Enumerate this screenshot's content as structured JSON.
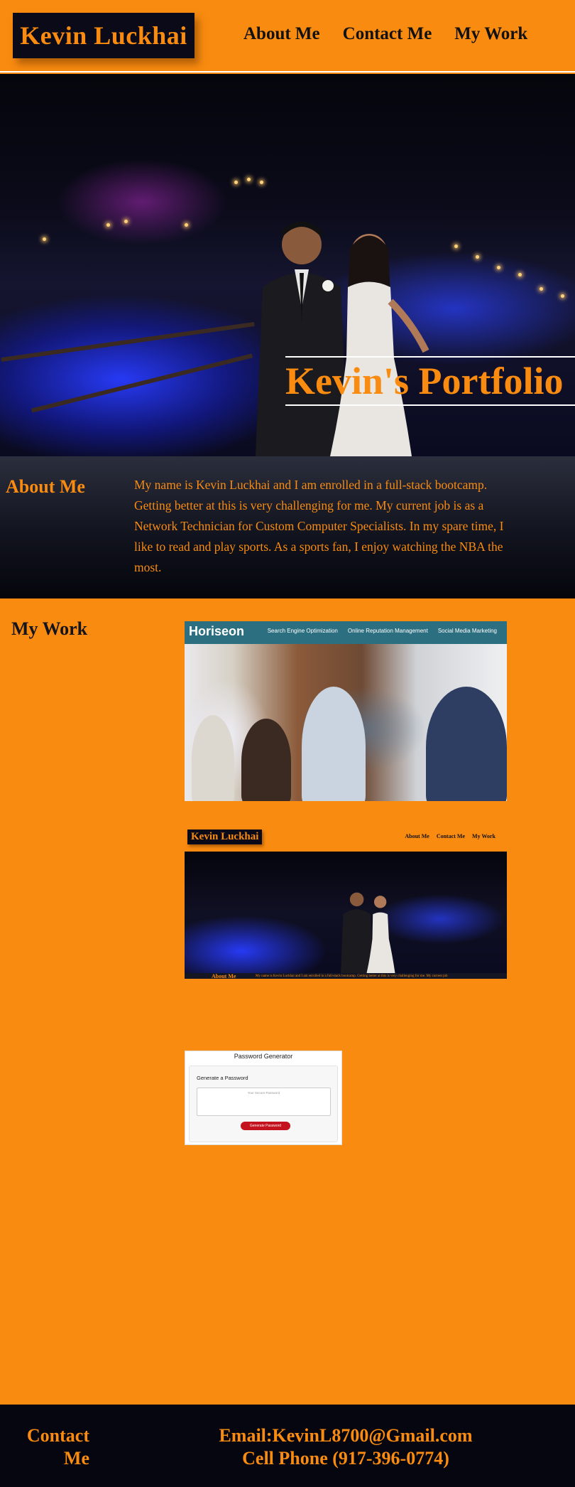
{
  "header": {
    "logo": "Kevin Luckhai",
    "nav": [
      "About Me",
      "Contact Me",
      "My Work"
    ]
  },
  "hero": {
    "title": "Kevin's Portfolio",
    "image_description_icon": "wedding-couple-photo"
  },
  "about": {
    "heading": "About Me",
    "text": "My name is Kevin Luckhai and I am enrolled in a full-stack bootcamp. Getting better at this is very challenging for me. My current job is as a Network Technician for Custom Computer Specialists. In my spare time, I like to read and play sports. As a sports fan, I enjoy watching the NBA the most."
  },
  "work": {
    "heading": "My Work",
    "projects": [
      {
        "logo": "Horiseon",
        "links": [
          "Search Engine Optimization",
          "Online Reputation Management",
          "Social Media Marketing"
        ]
      },
      {
        "logo": "Kevin Luckhai",
        "links": [
          "About Me",
          "Contact Me",
          "My Work"
        ],
        "about_heading": "About Me",
        "about_text": "My name is Kevin Luckhai and I am enrolled in a full-stack bootcamp. Getting better at this is very challenging for me. My current job"
      },
      {
        "title": "Password Generator",
        "card_heading": "Generate a Password",
        "placeholder": "Your Secure Password",
        "button": "Generate Password"
      }
    ]
  },
  "footer": {
    "heading": "Contact Me",
    "email": "Email:KevinL8700@Gmail.com",
    "phone": "Cell Phone (917-396-0774)"
  },
  "colors": {
    "accent": "#f98b10",
    "dark": "#0a0a18",
    "footer_bg": "#05060f"
  }
}
